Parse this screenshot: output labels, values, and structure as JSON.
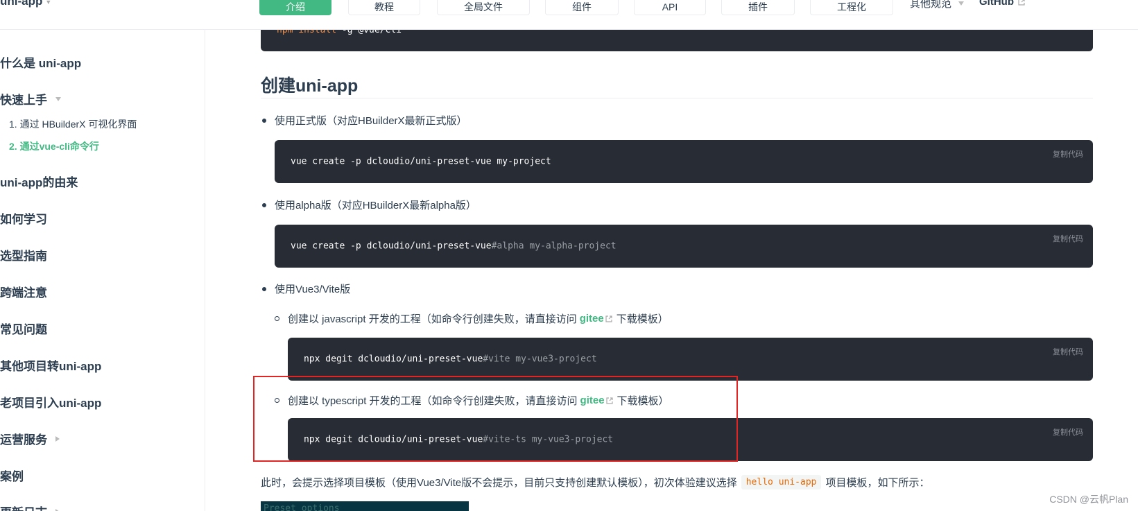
{
  "topbar": {
    "brand": "uni-app",
    "tabs": [
      {
        "label": "介绍",
        "active": true
      },
      {
        "label": "教程"
      },
      {
        "label": "全局文件"
      },
      {
        "label": "组件"
      },
      {
        "label": "API"
      },
      {
        "label": "插件"
      },
      {
        "label": "工程化"
      }
    ],
    "more": "其他规范",
    "github": "GitHub"
  },
  "sidebar": {
    "items": [
      {
        "label": "什么是 uni-app"
      },
      {
        "label": "快速上手"
      },
      {
        "label": "uni-app的由来"
      },
      {
        "label": "如何学习"
      },
      {
        "label": "选型指南"
      },
      {
        "label": "跨端注意"
      },
      {
        "label": "常见问题"
      },
      {
        "label": "其他项目转uni-app"
      },
      {
        "label": "老项目引入uni-app"
      },
      {
        "label": "运营服务"
      },
      {
        "label": "案例"
      },
      {
        "label": "更新日志"
      }
    ],
    "sub": [
      {
        "label": "1. 通过 HBuilderX 可视化界面"
      },
      {
        "label": "2. 通过vue-cli命令行",
        "active": true
      }
    ]
  },
  "main": {
    "top_code": {
      "kw": "npm install",
      "rest": " -g @vue/cli"
    },
    "heading": "创建uni-app",
    "copy_label": "复制代码",
    "b1": "使用正式版（对应HBuilderX最新正式版）",
    "code1": "vue create -p dcloudio/uni-preset-vue my-project",
    "b2": "使用alpha版（对应HBuilderX最新alpha版）",
    "code2_main": "vue create -p dcloudio/uni-preset-vue",
    "code2_comment": "#alpha my-alpha-project",
    "b3": "使用Vue3/Vite版",
    "s1_pre": "创建以 javascript 开发的工程（如命令行创建失败，请直接访问",
    "s1_link": "gitee",
    "s1_post": "下载模板）",
    "code3_main": "npx degit dcloudio/uni-preset-vue",
    "code3_comment": "#vite my-vue3-project",
    "s2_pre": "创建以 typescript 开发的工程（如命令行创建失败，请直接访问",
    "s2_link": "gitee",
    "s2_post": "下载模板）",
    "code4_main": "npx degit dcloudio/uni-preset-vue",
    "code4_comment": "#vite-ts my-vue3-project",
    "para_pre": "此时，会提示选择项目模板（使用Vue3/Vite版不会提示，目前只支持创建默认模板），初次体验建议选择",
    "para_code": "hello uni-app",
    "para_post": "项目模板，如下所示：",
    "preset": "Preset options"
  },
  "watermark": "CSDN @云帆Plan",
  "colors": {
    "accent": "#42b983",
    "code_bg": "#282c34",
    "highlight": "#e12424"
  }
}
